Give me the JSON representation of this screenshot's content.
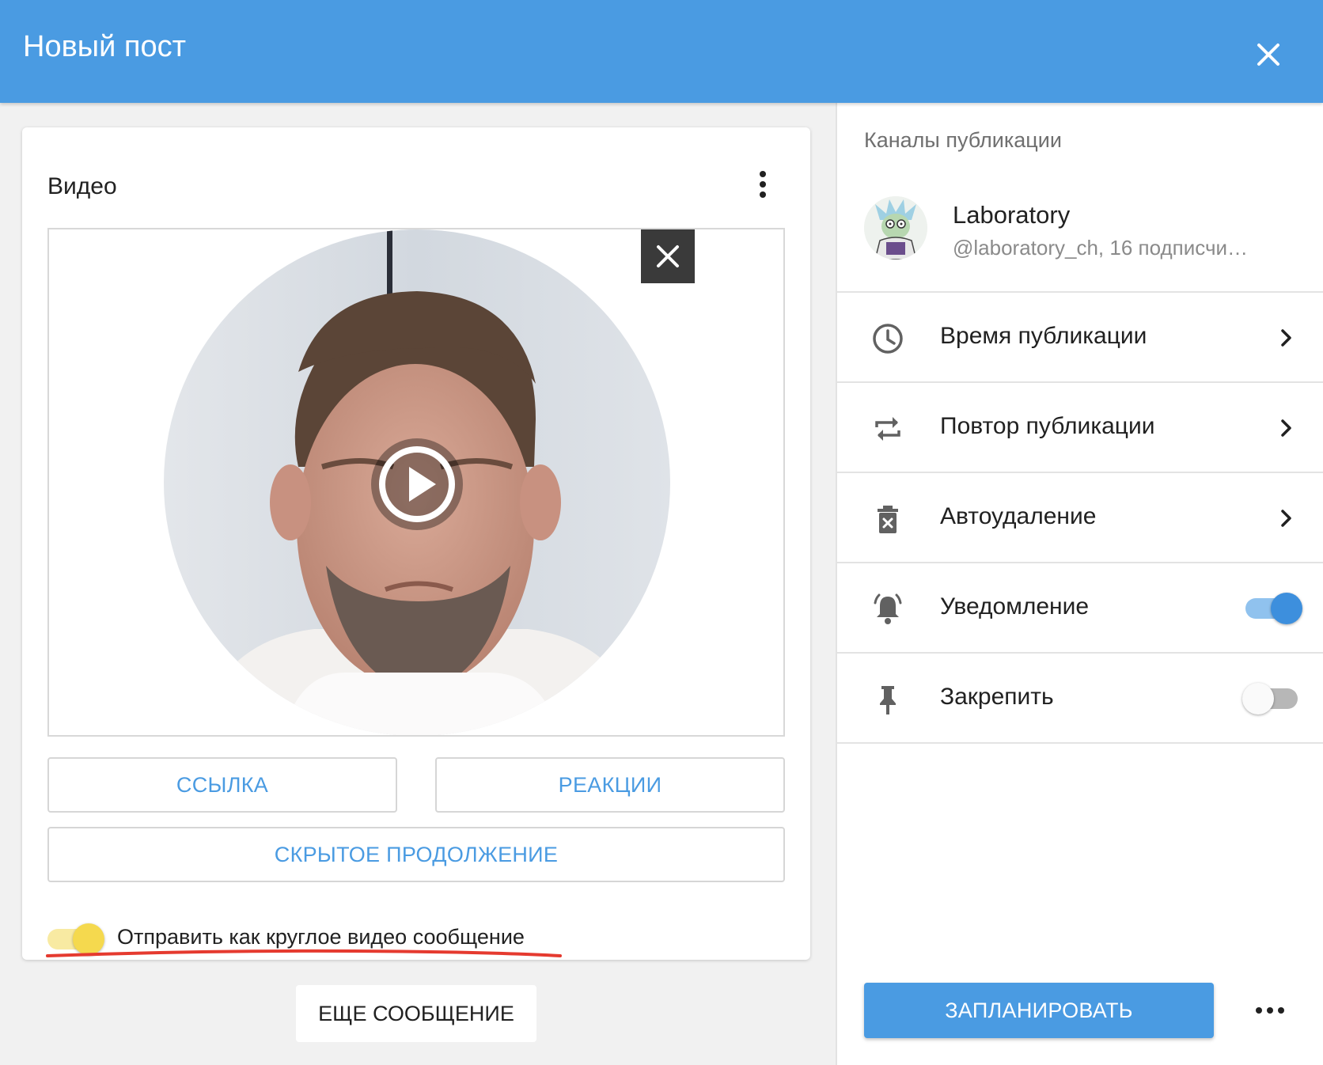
{
  "header": {
    "title": "Новый пост",
    "close_icon": "close-icon",
    "bg_color": "#4a9be2"
  },
  "editor": {
    "block_title": "Видео",
    "menu_icon": "more-vertical-icon",
    "video": {
      "remove_icon": "close-icon",
      "play_icon": "play-circle-icon"
    },
    "buttons": {
      "link": "ССЫЛКА",
      "reactions": "РЕАКЦИИ",
      "hidden_continuation": "СКРЫТОЕ ПРОДОЛЖЕНИЕ"
    },
    "round_video": {
      "label": "Отправить как круглое видео сообщение",
      "enabled": true,
      "toggle_color": "#f5d94e",
      "annotation_color": "#e53a2f"
    },
    "add_message_button": "ЕЩЕ СООБЩЕНИЕ"
  },
  "sidebar": {
    "section_title": "Каналы публикации",
    "channel": {
      "name": "Laboratory",
      "subtitle": "@laboratory_ch, 16 подписчи…"
    },
    "options": [
      {
        "label": "Время публикации",
        "icon": "clock-icon",
        "type": "link"
      },
      {
        "label": "Повтор публикации",
        "icon": "repeat-icon",
        "type": "link"
      },
      {
        "label": "Автоудаление",
        "icon": "trash-x-icon",
        "type": "link"
      },
      {
        "label": "Уведомление",
        "icon": "bell-ring-icon",
        "type": "toggle",
        "enabled": true
      },
      {
        "label": "Закрепить",
        "icon": "pin-icon",
        "type": "toggle",
        "enabled": false
      }
    ],
    "schedule_button": "ЗАПЛАНИРОВАТЬ",
    "more_icon": "more-horizontal-icon",
    "accent_color": "#4a9be2"
  }
}
